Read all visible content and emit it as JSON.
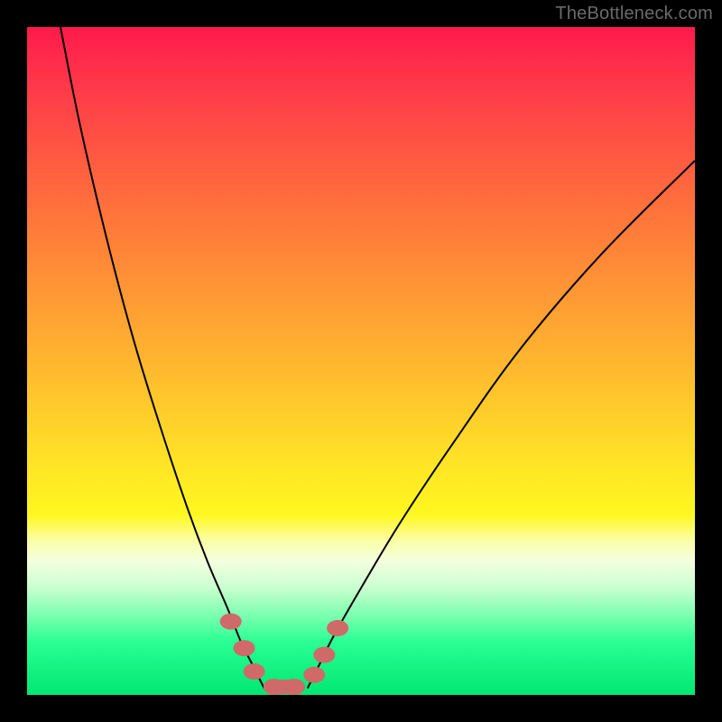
{
  "watermark": "TheBottleneck.com",
  "chart_data": {
    "type": "line",
    "title": "",
    "xlabel": "",
    "ylabel": "",
    "xlim": [
      0,
      100
    ],
    "ylim": [
      0,
      100
    ],
    "grid": false,
    "legend": false,
    "series": [
      {
        "name": "left-curve",
        "x": [
          5,
          8,
          12,
          16,
          20,
          24,
          27,
          30,
          32,
          33.5,
          34.5,
          35.5
        ],
        "y": [
          100,
          85,
          68,
          53,
          40,
          28,
          20,
          13,
          8,
          5,
          3,
          1
        ]
      },
      {
        "name": "right-curve",
        "x": [
          42,
          43.5,
          46,
          50,
          56,
          64,
          74,
          86,
          100
        ],
        "y": [
          1,
          4,
          9,
          16,
          26,
          38,
          52,
          66,
          80
        ]
      }
    ],
    "markers": {
      "name": "highlight-blobs",
      "color": "#cf6a68",
      "points": [
        {
          "x": 30.5,
          "y": 11
        },
        {
          "x": 32.5,
          "y": 7
        },
        {
          "x": 34,
          "y": 3.5
        },
        {
          "x": 37,
          "y": 1.2
        },
        {
          "x": 40,
          "y": 1.2
        },
        {
          "x": 43,
          "y": 3
        },
        {
          "x": 44.5,
          "y": 6
        },
        {
          "x": 46.5,
          "y": 10
        }
      ]
    }
  }
}
